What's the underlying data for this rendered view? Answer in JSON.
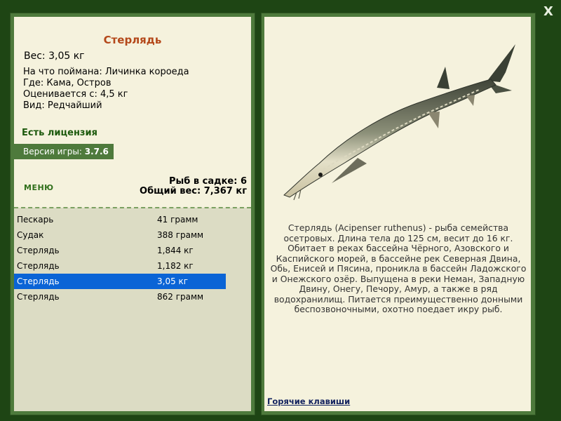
{
  "fish": {
    "title": "Стерлядь",
    "weight_line": "Вес: 3,05 кг",
    "caught_on": "На что поймана: Личинка короеда",
    "where": "Где: Кама, Остров",
    "valued_from": "Оценивается с: 4,5 кг",
    "kind": "Вид: Редчайший"
  },
  "license": "Есть лицензия",
  "version": {
    "label": "Версия игры: ",
    "value": "3.7.6"
  },
  "menu_label": "МЕНЮ",
  "keep": {
    "count": "Рыб в садке: 6",
    "total": "Общий вес: 7,367 кг"
  },
  "catch_list": [
    {
      "name": "Пескарь",
      "weight": "41 грамм"
    },
    {
      "name": "Судак",
      "weight": "388 грамм"
    },
    {
      "name": "Стерлядь",
      "weight": "1,844 кг"
    },
    {
      "name": "Стерлядь",
      "weight": "1,182 кг"
    },
    {
      "name": "Стерлядь",
      "weight": "3,05 кг"
    },
    {
      "name": "Стерлядь",
      "weight": "862 грамм"
    }
  ],
  "selected_index": 4,
  "description": "Стерлядь (Acipenser ruthenus) - рыба семейства осетровых. Длина тела до 125 см, весит до 16 кг. Обитает в реках бассейна Чёрного, Азовского и Каспийского морей, в бассейне рек Северная Двина, Обь, Енисей и Пясина, проникла в бассейн Ладожского и Онежского озёр. Выпущена в реки Неман, Западную Двину, Онегу, Печору, Амур, а также в ряд водохранилищ. Питается преимущественно донными беспозвоночными, охотно поедает икру рыб.",
  "hotkeys_label": "Горячие клавиши",
  "close_label": "X",
  "colors": {
    "background": "#1e4514",
    "frame": "#4e7a3c",
    "panel": "#f5f2dd",
    "list_bg": "#dcdcc4",
    "title": "#b4481a",
    "selection": "#0a64d6"
  },
  "fish_image": "sterlet-fish-illustration"
}
